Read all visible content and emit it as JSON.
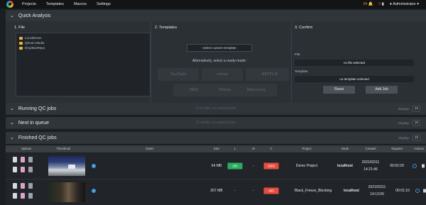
{
  "nav": {
    "items": [
      "Projects",
      "Templates",
      "Macros",
      "Settings"
    ]
  },
  "topbar": {
    "count_a": "24",
    "count_b": "0",
    "user": "Administrator"
  },
  "quick_analysis": {
    "title": "Quick Analysis",
    "file_col": "1. File",
    "folders": [
      "LocalDrives",
      "QScan Media",
      "DropBoxRepo"
    ],
    "templates_col": "2. Templates",
    "template_select": "- Select custom template -",
    "template_alt": "Alternatively, select a ready-made:",
    "template_logos": [
      "YouTube",
      "vimeo",
      "amazon",
      "NETFLIX",
      "HBO",
      "iTunes",
      "Discovery"
    ],
    "confirm_col": "3. Confirm",
    "file_label": "File:",
    "file_value": "no file selected",
    "template_label": "Template:",
    "template_value": "no template selected",
    "reset": "Reset",
    "add_job": "Add Job"
  },
  "running": {
    "title": "Running QC jobs",
    "status": "Currently, no running jobs",
    "display_label": "Display:",
    "display_value": "10"
  },
  "queue": {
    "title": "Next in queue",
    "status": "Currently, no queued jobs",
    "display_label": "Display:",
    "display_value": "10"
  },
  "finished": {
    "title": "Finished QC jobs",
    "display_label": "Display:",
    "display_value": "10",
    "columns": [
      "Options",
      "Thumbnail",
      "Name",
      "Size",
      "L",
      "M",
      "C",
      "Project",
      "Node",
      "Created",
      "Elapsed",
      "Actions"
    ],
    "rows": [
      {
        "size": "64 MB",
        "l": "185",
        "m": "-",
        "c": "2606",
        "project": "Demo Project",
        "node": "localhost",
        "created_date": "2021/02/11",
        "created_time": "14:21:46",
        "elapsed": "00:02:29"
      },
      {
        "size": "207 MB",
        "l": "-",
        "m": "-",
        "c": "485",
        "project": "Black_Freeze_Blocking",
        "node": "localhost",
        "created_date": "2021/02/11",
        "created_time": "14:13:00",
        "elapsed": "00:01:10"
      }
    ]
  },
  "colors": {
    "accent_green": "#27ae60",
    "accent_red": "#e74c3c",
    "info_blue": "#3498db"
  }
}
